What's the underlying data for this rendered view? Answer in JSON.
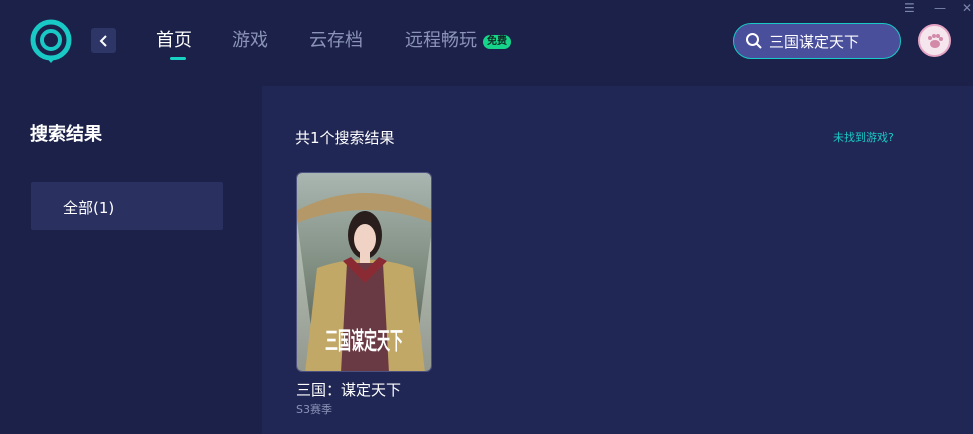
{
  "header": {
    "nav": [
      {
        "label": "首页",
        "active": true
      },
      {
        "label": "游戏",
        "active": false
      },
      {
        "label": "云存档",
        "active": false
      },
      {
        "label": "远程畅玩",
        "active": false
      }
    ],
    "free_badge": "免费",
    "search": {
      "value": "三国谋定天下"
    },
    "window_controls": [
      "☰",
      "—",
      "✕"
    ]
  },
  "sidebar": {
    "title": "搜索结果",
    "filters": [
      {
        "label": "全部(1)",
        "selected": true
      }
    ]
  },
  "main": {
    "result_count": "共1个搜索结果",
    "not_found_link": "未找到游戏?",
    "results": [
      {
        "name": "三国：谋定天下",
        "subtitle": "S3赛季",
        "cover_logo": "三国谋定天下"
      }
    ]
  },
  "colors": {
    "accent": "#19c9c6",
    "badge": "#17d48b",
    "background": "#1b2148",
    "panel": "#212755"
  },
  "icons": [
    "app-logo-icon",
    "back-arrow-icon",
    "search-icon",
    "avatar-paw-icon",
    "menu-icon",
    "minimize-icon",
    "close-icon"
  ]
}
